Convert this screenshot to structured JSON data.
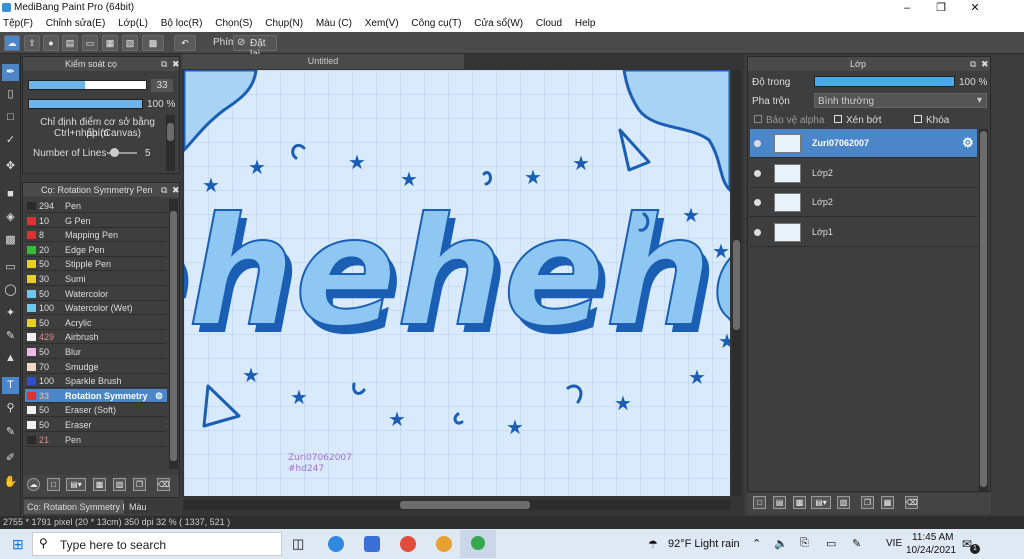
{
  "window": {
    "title": "MediBang Paint Pro (64bit)",
    "minimize_icon": "minimize-icon",
    "maximize_icon": "restore-icon",
    "close_icon": "close-icon"
  },
  "menu": [
    "Tệp(F)",
    "Chỉnh sửa(E)",
    "Lớp(L)",
    "Bộ lọc(R)",
    "Chọn(S)",
    "Chụp(N)",
    "Màu (C)",
    "Xem(V)",
    "Công cụ(T)",
    "Cửa sổ(W)",
    "Cloud",
    "Help"
  ],
  "toolbar": {
    "shortcut_label": "Phím",
    "reset_label": "Đặt lại"
  },
  "brush_control": {
    "title": "Kiểm soát cọ",
    "size_value": "33",
    "size_level": 0.48,
    "opacity_value": "100 %",
    "opacity_level": 1.0,
    "hint_line1": "Chỉ định điểm cơ sở bằng phím",
    "hint_line2": "Ctrl+nhấp (Canvas)",
    "lines_label": "Number of Lines",
    "lines_value": "5"
  },
  "brush_list": {
    "title": "Cọ: Rotation Symmetry Pen",
    "items": [
      {
        "size": "294",
        "name": "Pen",
        "color": "#2a2a2a",
        "size_color": "#dddddd"
      },
      {
        "size": "10",
        "name": "G Pen",
        "color": "#e03030",
        "size_color": "#dddddd"
      },
      {
        "size": "8",
        "name": "Mapping Pen",
        "color": "#e03030",
        "size_color": "#dddddd"
      },
      {
        "size": "20",
        "name": "Edge Pen",
        "color": "#30c030",
        "size_color": "#dddddd"
      },
      {
        "size": "50",
        "name": "Stipple Pen",
        "color": "#e8d020",
        "size_color": "#dddddd"
      },
      {
        "size": "30",
        "name": "Sumi",
        "color": "#e8d020",
        "size_color": "#dddddd"
      },
      {
        "size": "50",
        "name": "Watercolor",
        "color": "#6cc8f0",
        "size_color": "#dddddd"
      },
      {
        "size": "100",
        "name": "Watercolor (Wet)",
        "color": "#6cc8f0",
        "size_color": "#dddddd"
      },
      {
        "size": "50",
        "name": "Acrylic",
        "color": "#e8d020",
        "size_color": "#dddddd"
      },
      {
        "size": "429",
        "name": "Airbrush",
        "color": "#f0f0f0",
        "size_color": "#e08a8a"
      },
      {
        "size": "50",
        "name": "Blur",
        "color": "#f0b8e8",
        "size_color": "#dddddd"
      },
      {
        "size": "70",
        "name": "Smudge",
        "color": "#f0d8c8",
        "size_color": "#dddddd"
      },
      {
        "size": "100",
        "name": "Sparkle Brush",
        "color": "#3050d0",
        "size_color": "#dddddd"
      },
      {
        "size": "33",
        "name": "Rotation Symmetry",
        "color": "#e03030",
        "size_color": "#e08a8a"
      },
      {
        "size": "50",
        "name": "Eraser (Soft)",
        "color": "#f0f0f0",
        "size_color": "#dddddd"
      },
      {
        "size": "50",
        "name": "Eraser",
        "color": "#f0f0f0",
        "size_color": "#dddddd"
      },
      {
        "size": "21",
        "name": "Pen",
        "color": "#2a2a2a",
        "size_color": "#e08a8a"
      }
    ],
    "selected_index": 13
  },
  "bottom_tabs": {
    "brush_tab": "Cọ: Rotation Symmetry Pen",
    "color_tab": "Màu"
  },
  "canvas": {
    "tab_title": "Untitled",
    "main_text": "ehehehe",
    "signature_line1": "Zuri07062007",
    "signature_line2": "#hd247"
  },
  "layers": {
    "title": "Lớp",
    "opacity_label": "Độ trong",
    "opacity_value": "100 %",
    "opacity_level": 1.0,
    "blend_label": "Pha trộn",
    "blend_value": "Bình thường",
    "protect_alpha": "Bảo vệ alpha",
    "clipping": "Xén bớt",
    "lock": "Khóa",
    "items": [
      {
        "name": "Zuri07062007",
        "selected": true
      },
      {
        "name": "Lớp2",
        "selected": false
      },
      {
        "name": "Lớp2",
        "selected": false
      },
      {
        "name": "Lớp1",
        "selected": false
      }
    ]
  },
  "status_bar": {
    "text": "2755 * 1791 pixel  (20 * 13cm)  350 dpi  32 %  ( 1337, 521 )"
  },
  "taskbar": {
    "search_placeholder": "Type here to search",
    "weather": "92°F  Light rain",
    "language": "VIE",
    "time": "11:45 AM",
    "date": "10/24/2021",
    "notification_count": "1"
  },
  "colors": {
    "accent": "#4a86c8",
    "canvas_bg": "#d8eafc",
    "ink": "#1a5fb4",
    "letter_fill": "#8ec7f2"
  }
}
